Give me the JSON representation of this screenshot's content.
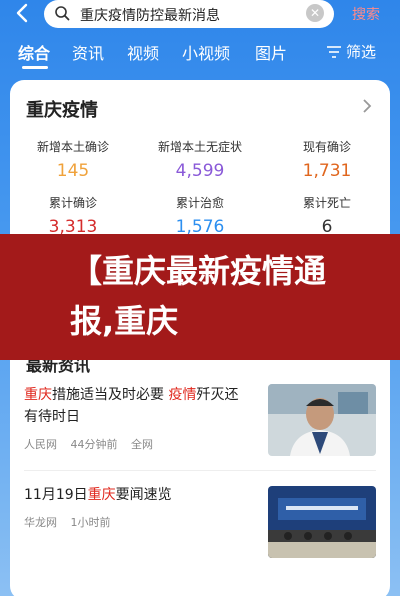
{
  "search": {
    "query": "重庆疫情防控最新消息",
    "button_label": "搜索"
  },
  "tabs": [
    {
      "label": "综合"
    },
    {
      "label": "资讯"
    },
    {
      "label": "视频"
    },
    {
      "label": "小视频"
    },
    {
      "label": "图片"
    }
  ],
  "filter_label": "筛选",
  "card": {
    "title": "重庆疫情",
    "stats": [
      {
        "label": "新增本土确诊",
        "value": "145",
        "color": "#f0a23b"
      },
      {
        "label": "新增本土无症状",
        "value": "4,599",
        "color": "#8a5ad8"
      },
      {
        "label": "现有确诊",
        "value": "1,731",
        "color": "#e0661e"
      },
      {
        "label": "累计确诊",
        "value": "3,313",
        "color": "#d52c2c"
      },
      {
        "label": "累计治愈",
        "value": "1,576",
        "color": "#2c8ff0"
      },
      {
        "label": "累计死亡",
        "value": "6",
        "color": "#333333"
      }
    ]
  },
  "banner": {
    "text": "【重庆最新疫情通报,重庆"
  },
  "news": {
    "header": "最新资讯",
    "items": [
      {
        "title_parts": [
          "重庆",
          "措施适当及时必要 ",
          "疫情",
          "歼灭还有待时日"
        ],
        "source": "人民网",
        "time": "44分钟前",
        "extra": "全网"
      },
      {
        "title_parts": [
          "11月19日",
          "重庆",
          "要闻速览"
        ],
        "source": "华龙网",
        "time": "1小时前"
      }
    ]
  },
  "colors": {
    "accent_blue": "#2f86ea",
    "highlight_red": "#e0281e",
    "banner_red": "#a31a1a"
  }
}
